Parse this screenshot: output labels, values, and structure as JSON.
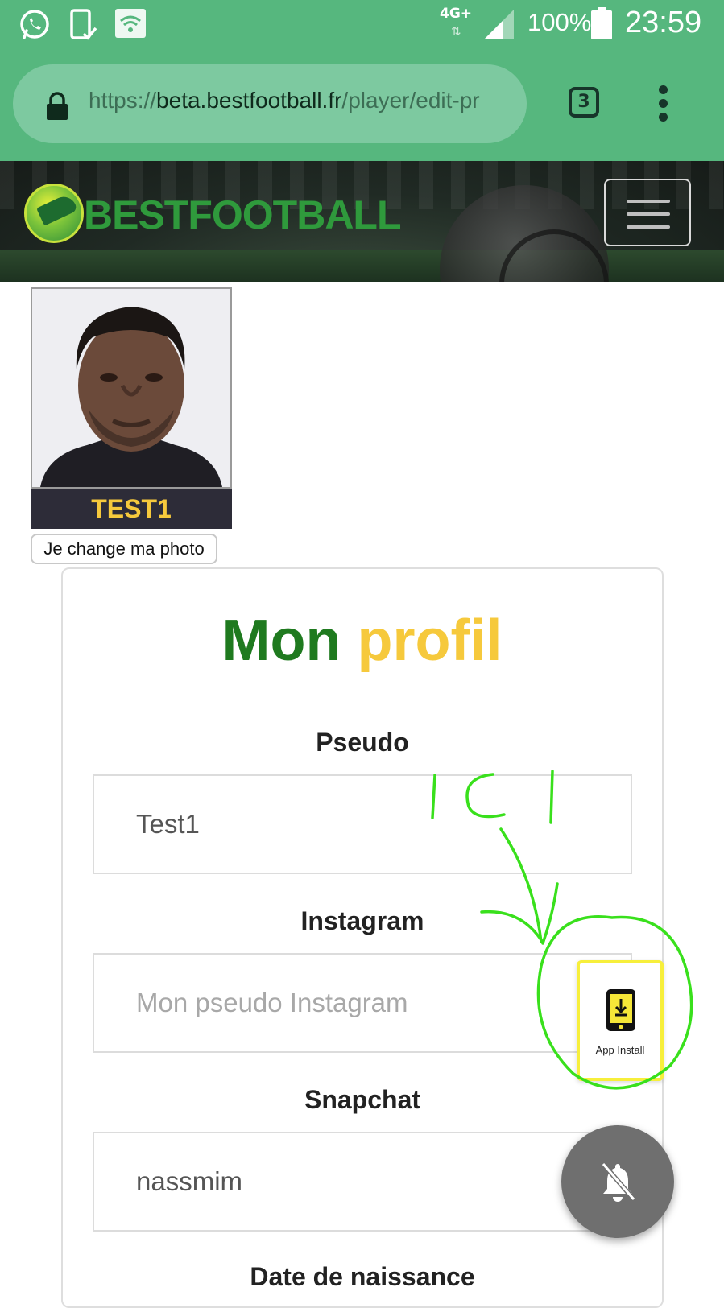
{
  "status_bar": {
    "network": "4G+",
    "battery": "100%",
    "time": "23:59",
    "icons": [
      "whatsapp-icon",
      "download-done-icon",
      "wifi-icon",
      "signal-icon",
      "battery-icon"
    ]
  },
  "browser": {
    "url_scheme": "https://",
    "url_host": "beta.bestfootball.fr",
    "url_path": "/player/edit-pr",
    "tab_count": "3"
  },
  "header": {
    "brand": "BESTFOOTBALL"
  },
  "profile": {
    "name": "TEST1",
    "change_photo_label": "Je change ma photo"
  },
  "form": {
    "title_part1": "Mon",
    "title_part2": "profil",
    "pseudo_label": "Pseudo",
    "pseudo_value": "Test1",
    "instagram_label": "Instagram",
    "instagram_placeholder": "Mon pseudo Instagram",
    "snapchat_label": "Snapchat",
    "snapchat_value": "nassmim",
    "birthdate_label": "Date de naissance"
  },
  "app_install": {
    "label": "App Install"
  },
  "annotation": {
    "text": "ICI"
  },
  "colors": {
    "status_bar_bg": "#56b77e",
    "title_green": "#1f7a1f",
    "title_yellow": "#f6c93c",
    "annotation_green": "#39e01c"
  }
}
